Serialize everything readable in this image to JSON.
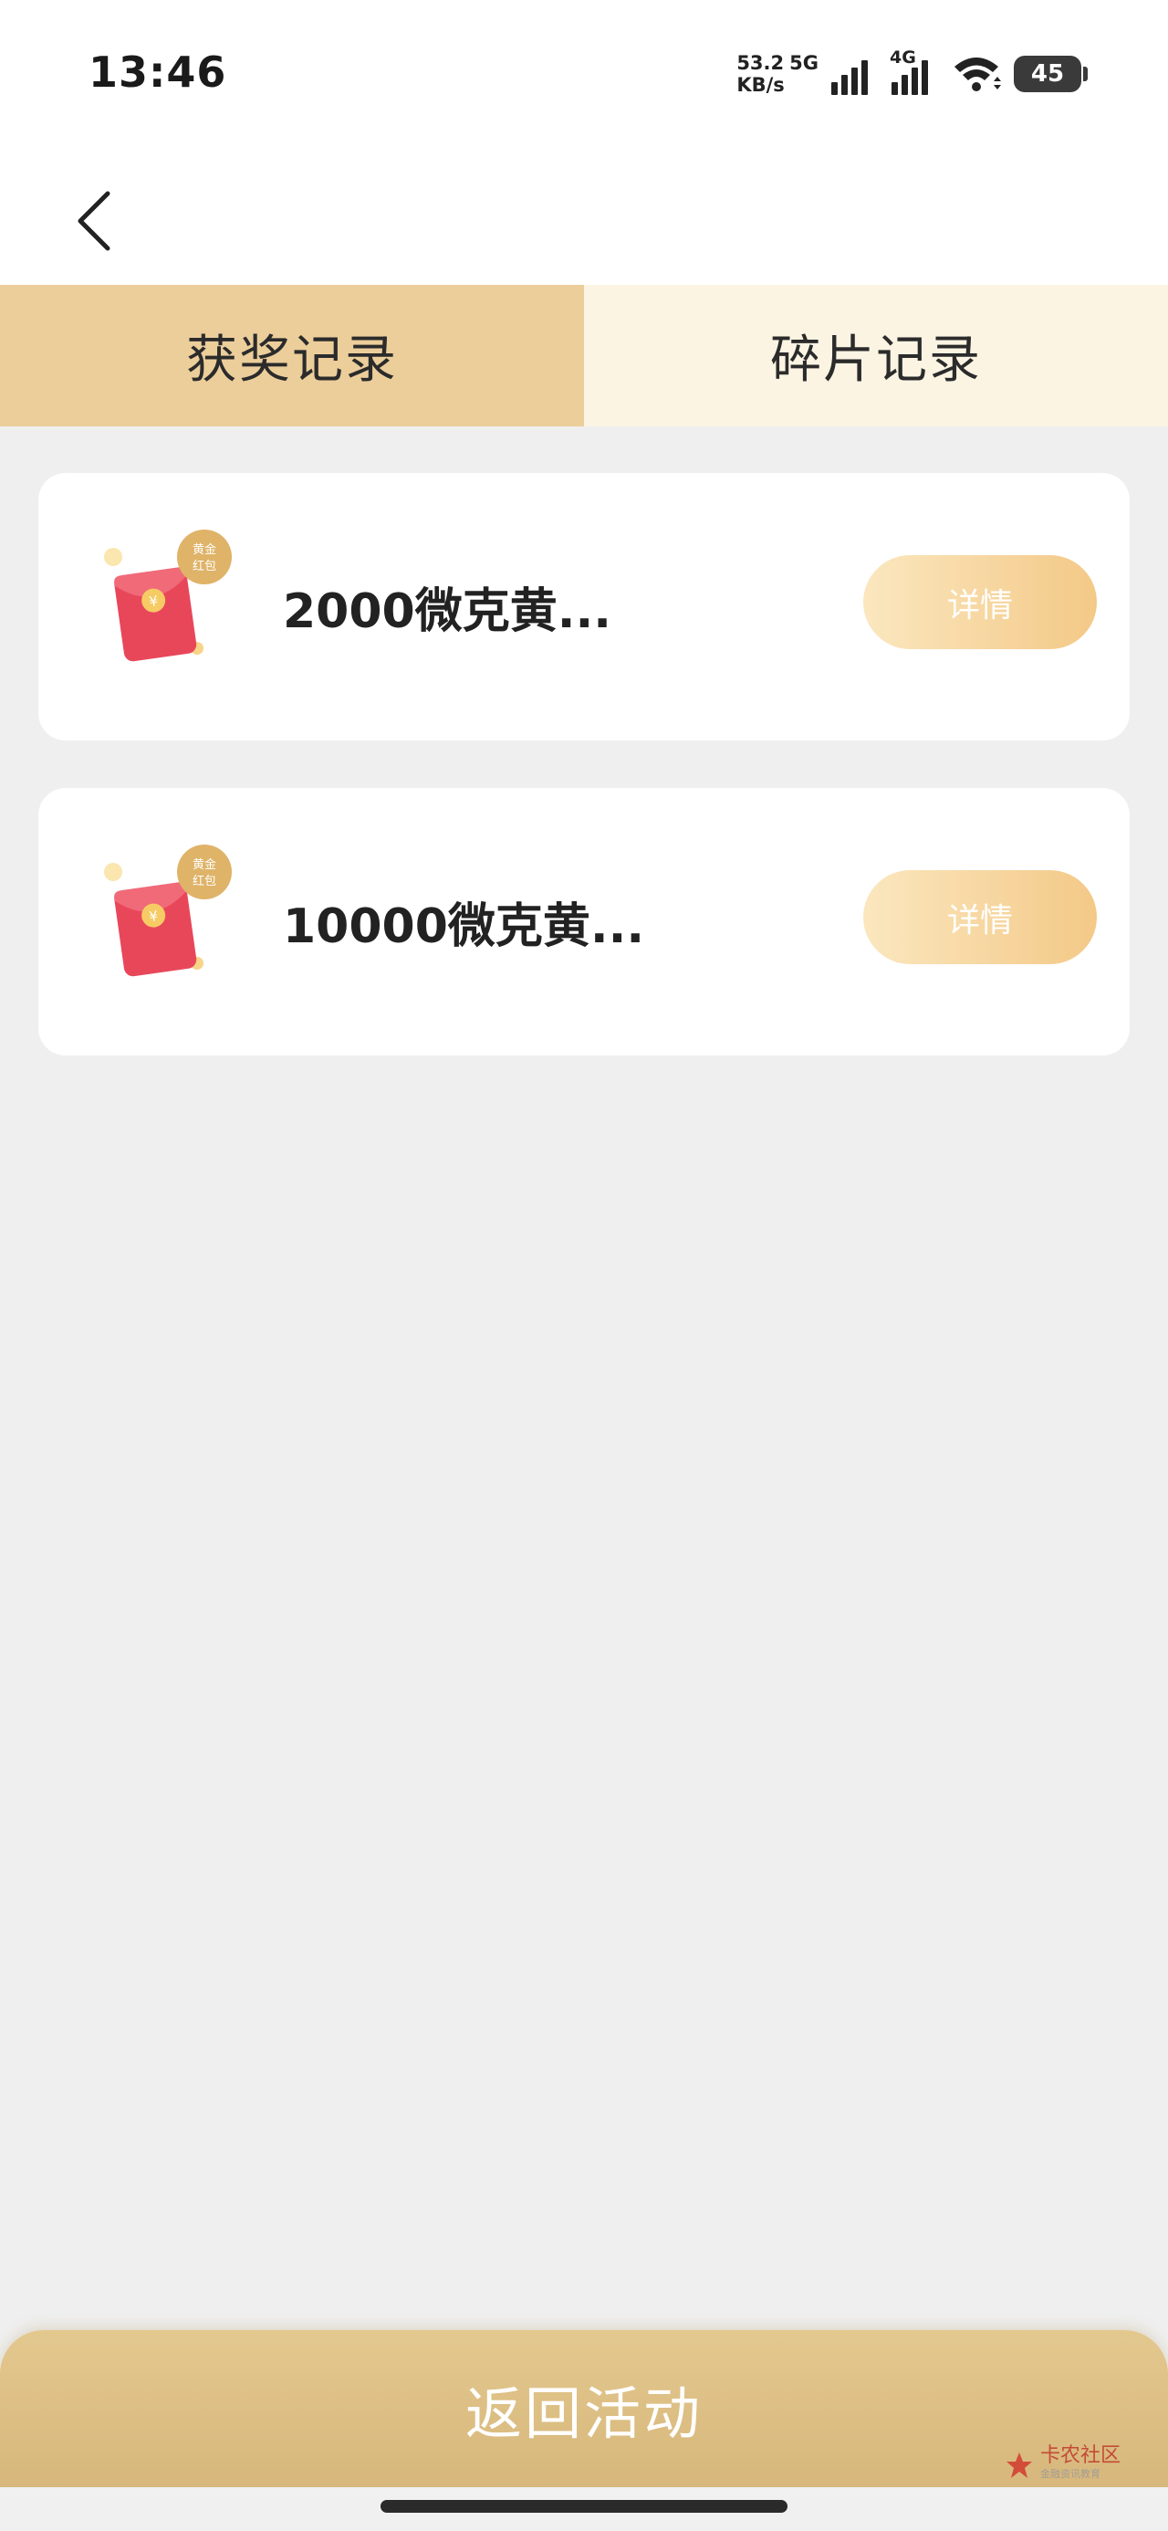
{
  "status_bar": {
    "time": "13:46",
    "net_speed_value": "53.2",
    "net_speed_unit": "KB/s",
    "net_type_1": "5G",
    "net_type_2": "4G",
    "battery_level": "45"
  },
  "nav": {
    "back_icon": "chevron-left-icon"
  },
  "tabs": [
    {
      "label": "获奖记录",
      "active": true
    },
    {
      "label": "碎片记录",
      "active": false
    }
  ],
  "records": [
    {
      "title": "2000微克黄...",
      "icon_badge_line1": "黄金",
      "icon_badge_line2": "红包",
      "detail_label": "详情"
    },
    {
      "title": "10000微克黄...",
      "icon_badge_line1": "黄金",
      "icon_badge_line2": "红包",
      "detail_label": "详情"
    }
  ],
  "bottom_button": {
    "label": "返回活动"
  },
  "watermark": {
    "label": "卡农社区",
    "sub": "金融资讯教育"
  },
  "colors": {
    "tab_active_bg": "#ecce9b",
    "tab_inactive_bg": "#fbf4e3",
    "detail_button_start": "#fbe7bf",
    "detail_button_end": "#f3c987",
    "bottom_button": "#dcbd82"
  }
}
